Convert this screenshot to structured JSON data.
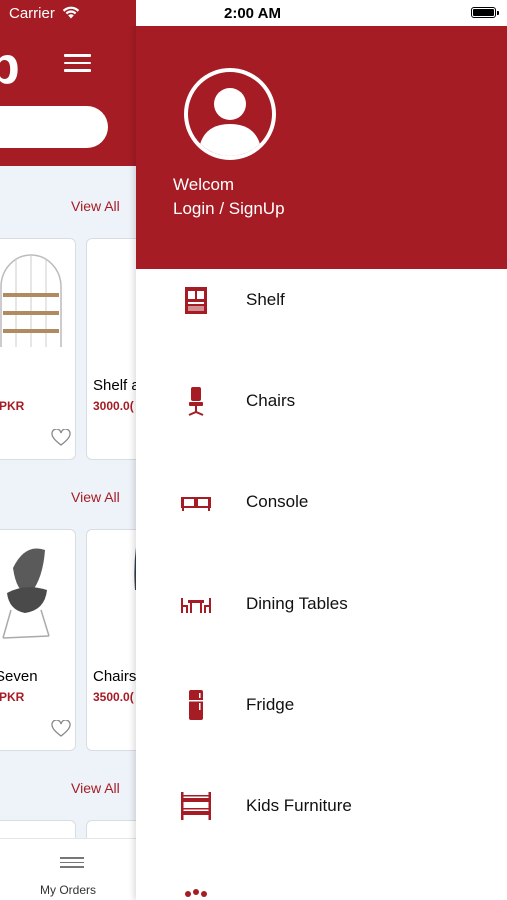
{
  "status_bar": {
    "carrier": "Carrier",
    "time": "2:00 AM"
  },
  "background_app": {
    "logo": "p",
    "sections": [
      {
        "view_all": "View All",
        "products": [
          {
            "name": "",
            "price": "PKR"
          },
          {
            "name": "Shelf a",
            "price": "3000.0("
          }
        ]
      },
      {
        "view_all": "View All",
        "products": [
          {
            "name": "Seven",
            "price": "PKR"
          },
          {
            "name": "Chairs",
            "price": "3500.0("
          }
        ]
      },
      {
        "view_all": "View All"
      }
    ],
    "bottom_nav": {
      "orders_label": "My Orders"
    }
  },
  "drawer": {
    "welcome": "Welcom",
    "login": "Login / SignUp",
    "items": [
      {
        "label": "Shelf",
        "icon": "shelf-icon"
      },
      {
        "label": "Chairs",
        "icon": "chair-icon"
      },
      {
        "label": "Console",
        "icon": "console-icon"
      },
      {
        "label": "Dining Tables",
        "icon": "dining-table-icon"
      },
      {
        "label": "Fridge",
        "icon": "fridge-icon"
      },
      {
        "label": "Kids Furniture",
        "icon": "bunk-bed-icon"
      }
    ]
  },
  "colors": {
    "brand": "#a51c24",
    "background": "#eef3f9"
  }
}
